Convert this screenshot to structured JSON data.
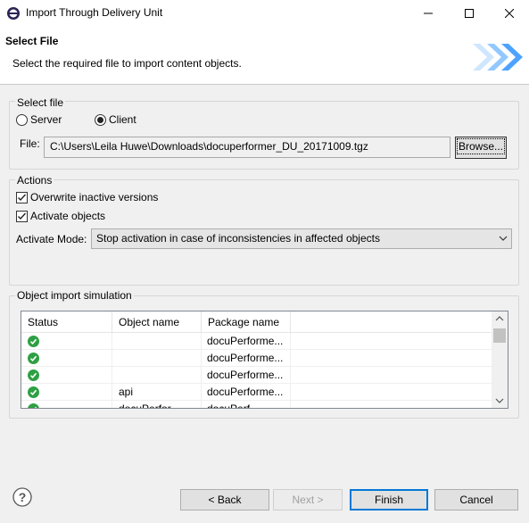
{
  "window": {
    "title": "Import Through Delivery Unit"
  },
  "header": {
    "title": "Select File",
    "description": "Select the required file to import content objects."
  },
  "select_file": {
    "group_label": "Select file",
    "options": [
      "Server",
      "Client"
    ],
    "selected": "Client",
    "file_label": "File:",
    "file_value": "C:\\Users\\Leila Huwe\\Downloads\\docuperformer_DU_20171009.tgz",
    "browse_label": "Browse..."
  },
  "actions": {
    "group_label": "Actions",
    "overwrite_label": "Overwrite inactive versions",
    "overwrite_checked": true,
    "activate_label": "Activate objects",
    "activate_checked": true,
    "mode_label": "Activate Mode:",
    "mode_value": "Stop activation in case of inconsistencies in affected objects"
  },
  "simulation": {
    "group_label": "Object import simulation",
    "columns": [
      "Status",
      "Object name",
      "Package name"
    ],
    "rows": [
      {
        "status": "ok",
        "object": "",
        "package": "docuPerforme..."
      },
      {
        "status": "ok",
        "object": "",
        "package": "docuPerforme..."
      },
      {
        "status": "ok",
        "object": "",
        "package": "docuPerforme..."
      },
      {
        "status": "ok",
        "object": "api",
        "package": "docuPerforme..."
      },
      {
        "status": "ok",
        "object": "docuPerfor...",
        "package": "docuPerf..."
      }
    ]
  },
  "footer": {
    "back_label": "< Back",
    "next_label": "Next >",
    "finish_label": "Finish",
    "cancel_label": "Cancel"
  },
  "colors": {
    "accent": "#0078d7",
    "status_ok": "#2ea043",
    "banner_arrow": "#4da3ff"
  }
}
